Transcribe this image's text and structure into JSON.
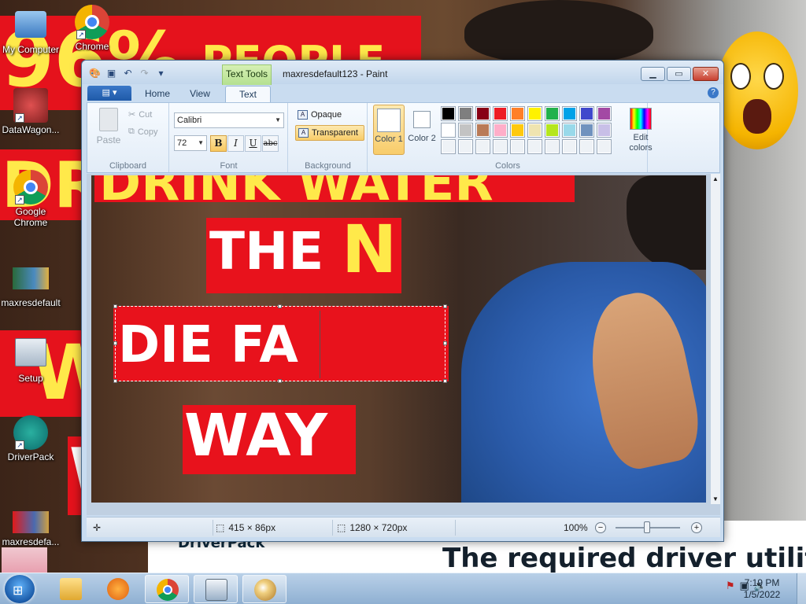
{
  "window": {
    "title": "maxresdefault123 - Paint",
    "contextual_tab": "Text Tools"
  },
  "ribbon_tabs": [
    "Home",
    "View",
    "Text"
  ],
  "active_tab": "Text",
  "clipboard": {
    "paste": "Paste",
    "cut": "Cut",
    "copy": "Copy",
    "label": "Clipboard"
  },
  "font": {
    "family": "Calibri",
    "size": "72",
    "bold": "B",
    "italic": "I",
    "underline": "U",
    "strikethrough": "abc",
    "label": "Font"
  },
  "background": {
    "opaque": "Opaque",
    "transparent": "Transparent",
    "label": "Background"
  },
  "colors": {
    "color1_label": "Color 1",
    "color2_label": "Color 2",
    "color1_value": "#ffffff",
    "color2_value": "#ffffff",
    "edit_label": "Edit colors",
    "label": "Colors",
    "palette_row1": [
      "#000000",
      "#7f7f7f",
      "#880015",
      "#ed1c24",
      "#ff7f27",
      "#fff200",
      "#22b14c",
      "#00a2e8",
      "#3f48cc",
      "#a349a4"
    ],
    "palette_row2": [
      "#ffffff",
      "#c3c3c3",
      "#b97a57",
      "#ffaec9",
      "#ffc90e",
      "#efe4b0",
      "#b5e61d",
      "#99d9ea",
      "#7092be",
      "#c8bfe7"
    ]
  },
  "canvas": {
    "line1": "DRINK WATER",
    "line2_a": "THE",
    "line2_b": "N",
    "line3": "DIE FA",
    "line4": "WAY"
  },
  "status": {
    "selection_size": "415 × 86px",
    "image_size": "1280 × 720px",
    "zoom": "100%"
  },
  "desktop": {
    "icons": [
      "My Computer",
      "Chrome",
      "DataWagon...",
      "Google Chrome",
      "maxresdefault",
      "Setup",
      "DriverPack",
      "maxresdefa..."
    ],
    "wallpaper_text": [
      "96%",
      "PEOPLE",
      "DR",
      "W",
      "W"
    ],
    "bottom_text": "The required driver utiliti",
    "bottom_brand": "DriverPack"
  },
  "taskbar": {
    "time": "7:19 PM",
    "date": "1/5/2022"
  }
}
